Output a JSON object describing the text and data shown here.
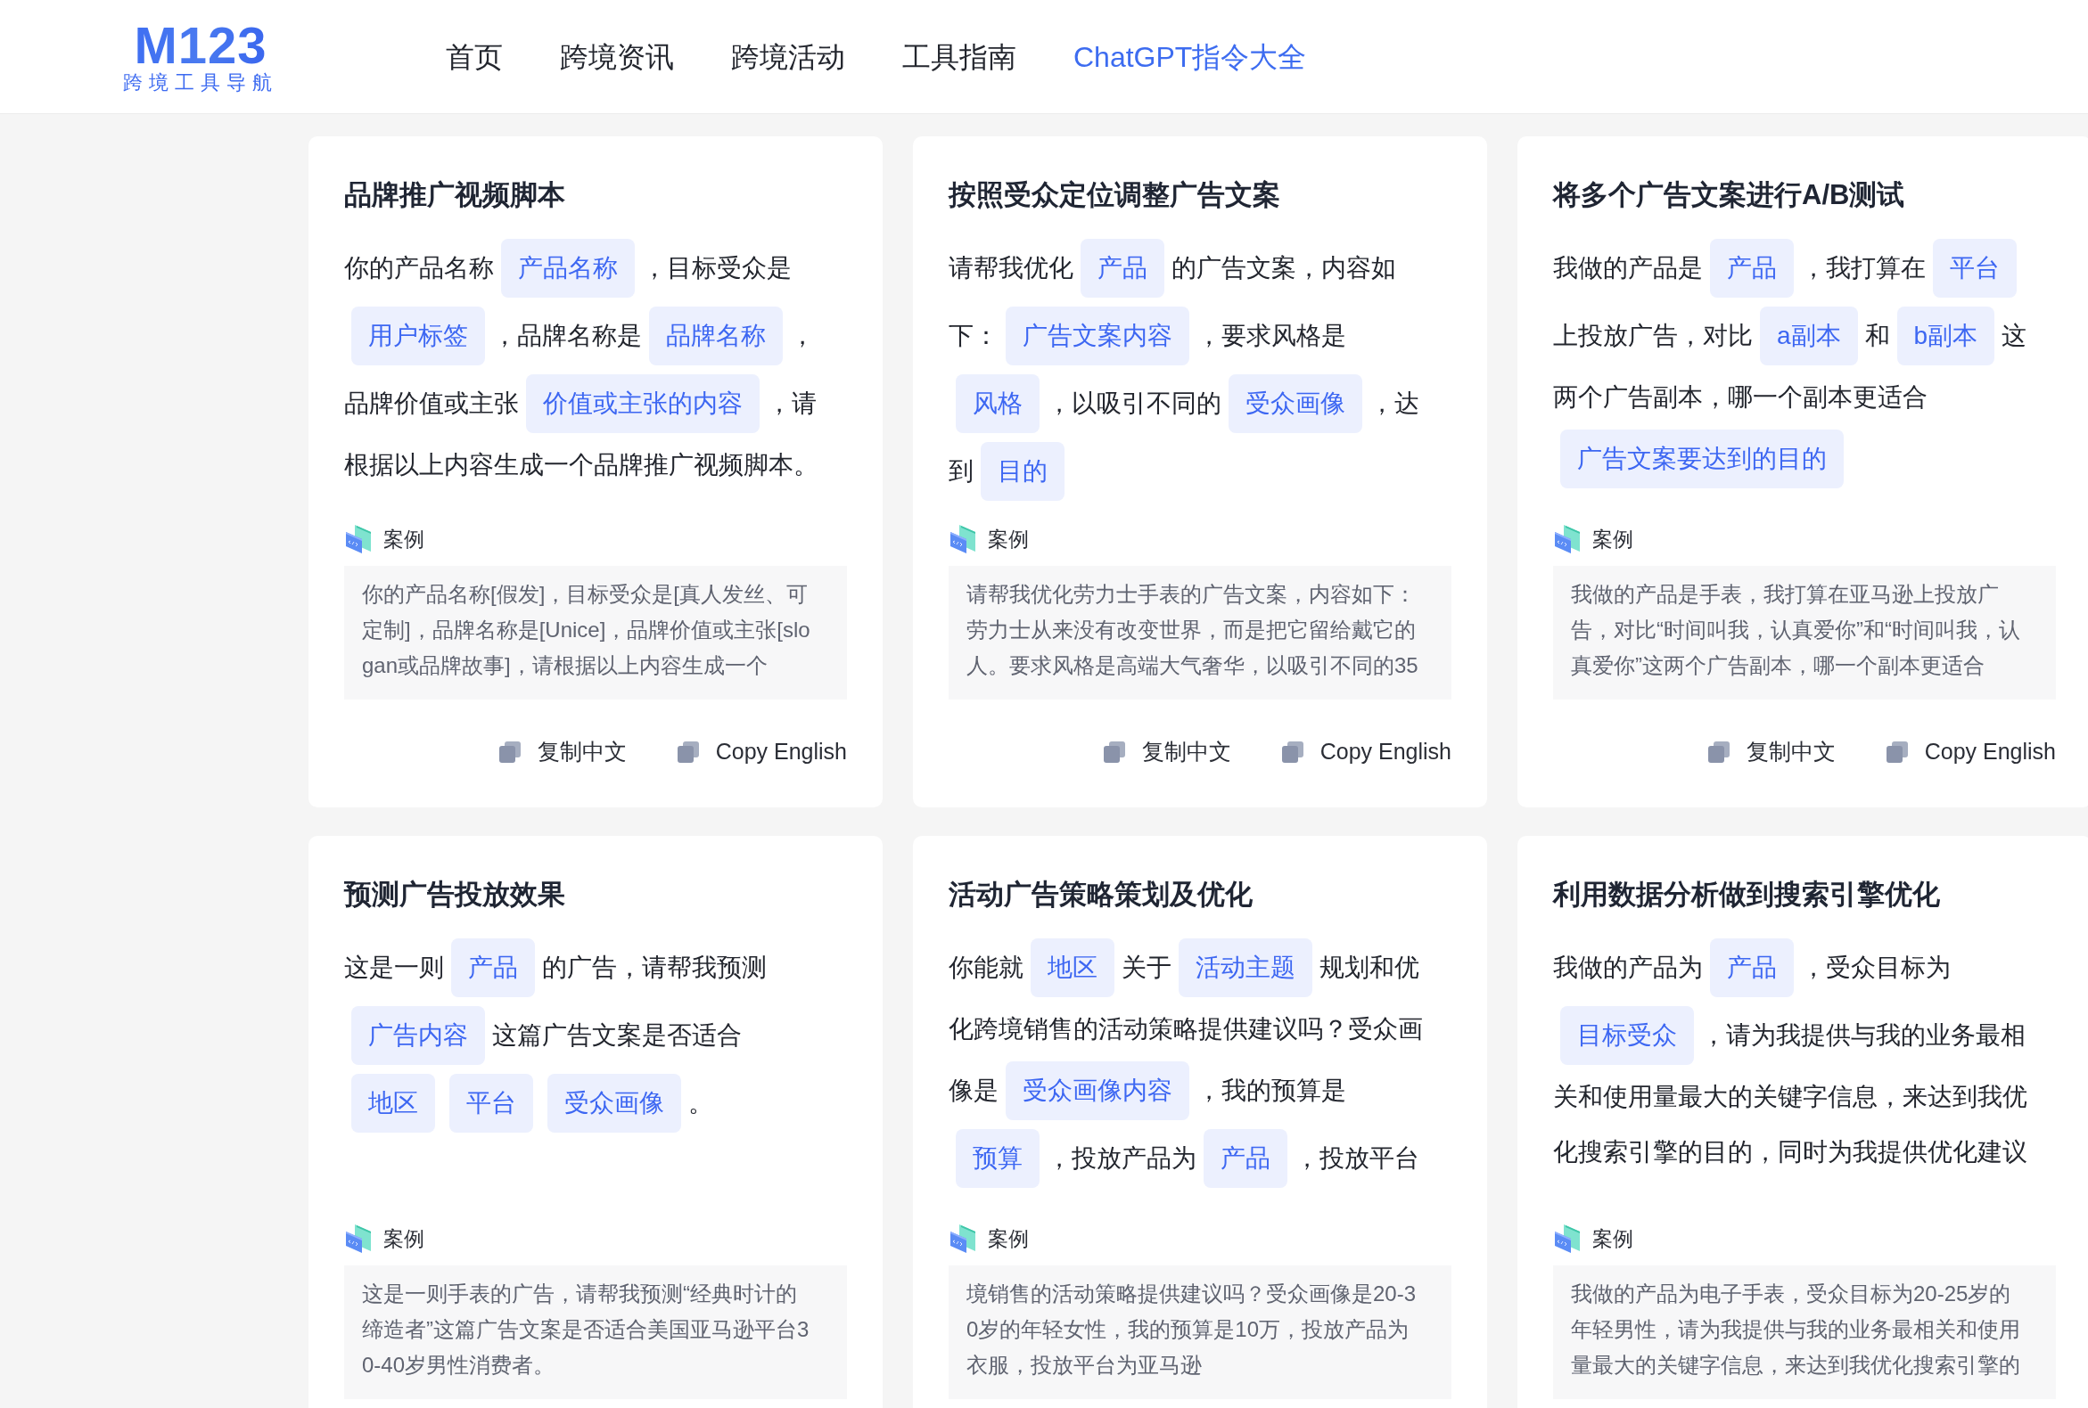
{
  "header": {
    "logo": {
      "mark": "M123",
      "tagline": "跨境工具导航"
    },
    "nav": [
      {
        "label": "首页",
        "selected": false
      },
      {
        "label": "跨境资讯",
        "selected": false
      },
      {
        "label": "跨境活动",
        "selected": false
      },
      {
        "label": "工具指南",
        "selected": false
      },
      {
        "label": "ChatGPT指令大全",
        "selected": true
      }
    ]
  },
  "cards": [
    {
      "title": "品牌推广视频脚本",
      "prompt_lines": [
        [
          {
            "kind": "text",
            "text": "你的产品名称"
          },
          {
            "kind": "chip",
            "text": "产品名称"
          },
          {
            "kind": "text",
            "text": "，目标受众是"
          }
        ],
        [
          {
            "kind": "chip",
            "text": "用户标签"
          },
          {
            "kind": "text",
            "text": "，品牌名称是"
          },
          {
            "kind": "chip",
            "text": "品牌名称"
          },
          {
            "kind": "text",
            "text": "，"
          }
        ],
        [
          {
            "kind": "text",
            "text": "品牌价值或主张"
          },
          {
            "kind": "chip",
            "text": "价值或主张的内容"
          },
          {
            "kind": "text",
            "text": "，请"
          }
        ],
        [
          {
            "kind": "text",
            "text": "根据以上内容生成一个品牌推广视频脚本。"
          }
        ]
      ],
      "example_label": "案例",
      "example": "你的产品名称[假发]，目标受众是[真人发丝、可定制]，品牌名称是[Unice]，品牌价值或主张[slogan或品牌故事]，请根据以上内容生成一个",
      "actions": [
        "复制中文",
        "Copy English"
      ]
    },
    {
      "title": "按照受众定位调整广告文案",
      "prompt_lines": [
        [
          {
            "kind": "text",
            "text": "请帮我优化"
          },
          {
            "kind": "chip",
            "text": "产品"
          },
          {
            "kind": "text",
            "text": "的广告文案，内容如"
          }
        ],
        [
          {
            "kind": "text",
            "text": "下："
          },
          {
            "kind": "chip",
            "text": "广告文案内容"
          },
          {
            "kind": "text",
            "text": "，要求风格是"
          }
        ],
        [
          {
            "kind": "chip",
            "text": "风格"
          },
          {
            "kind": "text",
            "text": "，以吸引不同的"
          },
          {
            "kind": "chip",
            "text": "受众画像"
          },
          {
            "kind": "text",
            "text": "，达"
          }
        ],
        [
          {
            "kind": "text",
            "text": "到"
          },
          {
            "kind": "chip",
            "text": "目的"
          }
        ]
      ],
      "example_label": "案例",
      "example": "请帮我优化劳力士手表的广告文案，内容如下：劳力士从来没有改变世界，而是把它留给戴它的人。要求风格是高端大气奢华，以吸引不同的35",
      "actions": [
        "复制中文",
        "Copy English"
      ]
    },
    {
      "title": "将多个广告文案进行A/B测试",
      "prompt_lines": [
        [
          {
            "kind": "text",
            "text": "我做的产品是"
          },
          {
            "kind": "chip",
            "text": "产品"
          },
          {
            "kind": "text",
            "text": "，我打算在"
          },
          {
            "kind": "chip",
            "text": "平台"
          }
        ],
        [
          {
            "kind": "text",
            "text": "上投放广告，对比"
          },
          {
            "kind": "chip",
            "text": "a副本"
          },
          {
            "kind": "text",
            "text": "和"
          },
          {
            "kind": "chip",
            "text": "b副本"
          },
          {
            "kind": "text",
            "text": "这"
          }
        ],
        [
          {
            "kind": "text",
            "text": "两个广告副本，哪一个副本更适合"
          }
        ],
        [
          {
            "kind": "chip",
            "text": "广告文案要达到的目的"
          }
        ]
      ],
      "example_label": "案例",
      "example": "我做的产品是手表，我打算在亚马逊上投放广告，对比“时间叫我，认真爱你”和“时间叫我，认真爱你”这两个广告副本，哪一个副本更适合",
      "actions": [
        "复制中文",
        "Copy English"
      ]
    },
    {
      "title": "预测广告投放效果",
      "prompt_lines": [
        [
          {
            "kind": "text",
            "text": "这是一则"
          },
          {
            "kind": "chip",
            "text": "产品"
          },
          {
            "kind": "text",
            "text": "的广告，请帮我预测"
          }
        ],
        [
          {
            "kind": "chip",
            "text": "广告内容"
          },
          {
            "kind": "text",
            "text": "这篇广告文案是否适合"
          }
        ],
        [
          {
            "kind": "chip",
            "text": "地区"
          },
          {
            "kind": "chip",
            "text": "平台"
          },
          {
            "kind": "chip",
            "text": "受众画像"
          },
          {
            "kind": "text",
            "text": "。"
          }
        ]
      ],
      "example_label": "案例",
      "example": "这是一则手表的广告，请帮我预测“经典时计的缔造者”这篇广告文案是否适合美国亚马逊平台30-40岁男性消费者。"
    },
    {
      "title": "活动广告策略策划及优化",
      "prompt_lines": [
        [
          {
            "kind": "text",
            "text": "你能就"
          },
          {
            "kind": "chip",
            "text": "地区"
          },
          {
            "kind": "text",
            "text": "关于"
          },
          {
            "kind": "chip",
            "text": "活动主题"
          },
          {
            "kind": "text",
            "text": "规划和优"
          }
        ],
        [
          {
            "kind": "text",
            "text": "化跨境销售的活动策略提供建议吗？受众画"
          }
        ],
        [
          {
            "kind": "text",
            "text": "像是"
          },
          {
            "kind": "chip",
            "text": "受众画像内容"
          },
          {
            "kind": "text",
            "text": "，我的预算是"
          }
        ],
        [
          {
            "kind": "chip",
            "text": "预算"
          },
          {
            "kind": "text",
            "text": "，投放产品为"
          },
          {
            "kind": "chip",
            "text": "产品"
          },
          {
            "kind": "text",
            "text": "，投放平台"
          }
        ]
      ],
      "example_label": "案例",
      "example": "境销售的活动策略提供建议吗？受众画像是20-30岁的年轻女性，我的预算是10万，投放产品为衣服，投放平台为亚马逊"
    },
    {
      "title": "利用数据分析做到搜索引擎优化",
      "prompt_lines": [
        [
          {
            "kind": "text",
            "text": "我做的产品为"
          },
          {
            "kind": "chip",
            "text": "产品"
          },
          {
            "kind": "text",
            "text": "，受众目标为"
          }
        ],
        [
          {
            "kind": "chip",
            "text": "目标受众"
          },
          {
            "kind": "text",
            "text": "，请为我提供与我的业务最相"
          }
        ],
        [
          {
            "kind": "text",
            "text": "关和使用量最大的关键字信息，来达到我优"
          }
        ],
        [
          {
            "kind": "text",
            "text": "化搜索引擎的目的，同时为我提供优化建议"
          }
        ]
      ],
      "example_label": "案例",
      "example": "我做的产品为电子手表，受众目标为20-25岁的年轻男性，请为我提供与我的业务最相关和使用量最大的关键字信息，来达到我优化搜索引擎的"
    }
  ]
}
